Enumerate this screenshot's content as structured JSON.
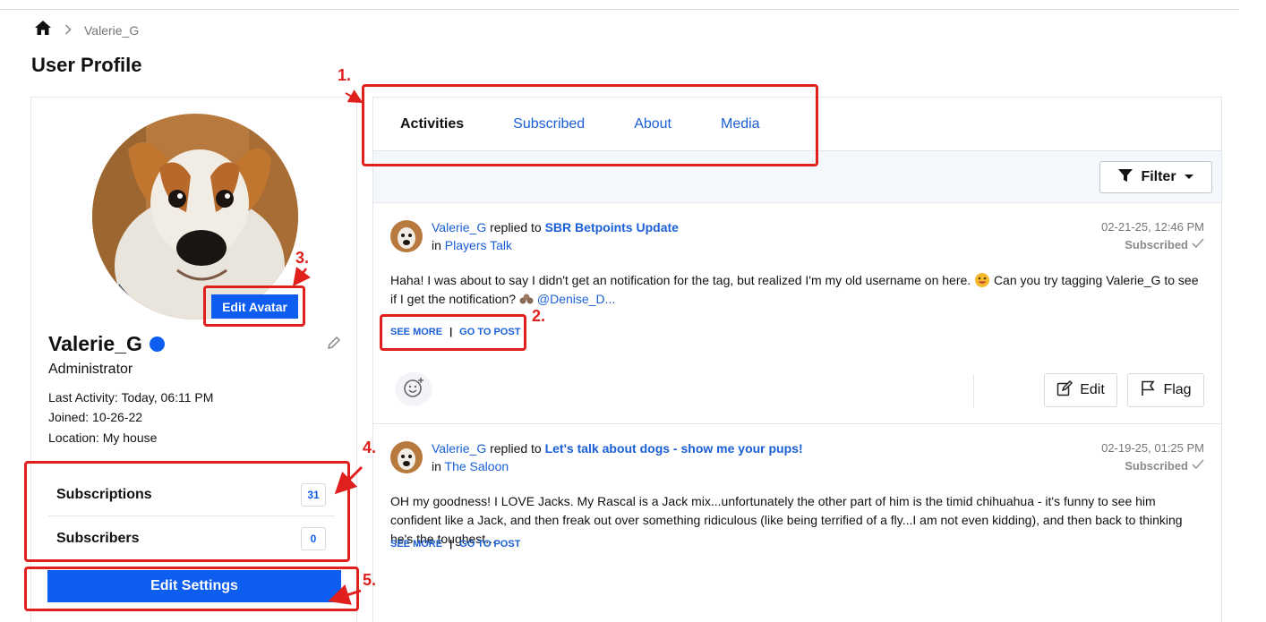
{
  "breadcrumb": {
    "current": "Valerie_G"
  },
  "page": {
    "title": "User Profile"
  },
  "profile": {
    "username": "Valerie_G",
    "role": "Administrator",
    "last_activity": "Last Activity: Today, 06:11 PM",
    "joined": "Joined: 10-26-22",
    "location": "Location: My house",
    "edit_avatar_label": "Edit Avatar",
    "subscriptions_label": "Subscriptions",
    "subscriptions_count": "31",
    "subscribers_label": "Subscribers",
    "subscribers_count": "0",
    "edit_settings_label": "Edit Settings"
  },
  "tabs": [
    {
      "label": "Activities",
      "active": true
    },
    {
      "label": "Subscribed"
    },
    {
      "label": "About"
    },
    {
      "label": "Media"
    }
  ],
  "filter": {
    "label": "Filter"
  },
  "posts": [
    {
      "author": "Valerie_G",
      "action": "replied to",
      "thread": "SBR Betpoints Update",
      "in_label": "in",
      "forum": "Players Talk",
      "date": "02-21-25, 12:46 PM",
      "subscribed": "Subscribed",
      "body_1": "Haha! I was about to say I didn't get an notification for the tag, but realized I'm my old username on here.",
      "body_2": "Can you try tagging Valerie_G to see if I get the notification?",
      "mention": "@Denise_D...",
      "see_more": "SEE MORE",
      "go_to_post": "GO TO POST",
      "edit_label": "Edit",
      "flag_label": "Flag"
    },
    {
      "author": "Valerie_G",
      "action": "replied to",
      "thread": "Let's talk about dogs - show me your pups!",
      "in_label": "in",
      "forum": "The Saloon",
      "date": "02-19-25, 01:25 PM",
      "subscribed": "Subscribed",
      "body": "OH my goodness! I LOVE Jacks. My Rascal is a Jack mix...unfortunately the other part of him is the timid chihuahua - it's funny to see him confident like a Jack, and then freak out over something ridiculous (like being terrified of a fly...I am not even kidding), and then back to thinking he's the toughest...",
      "see_more": "SEE MORE",
      "go_to_post": "GO TO POST"
    }
  ],
  "annotations": [
    "1.",
    "2.",
    "3.",
    "4.",
    "5."
  ],
  "colors": {
    "accent": "#0d5ef0",
    "link": "#1a5fd6",
    "annotation": "#e0201c",
    "online": "#0d5ef0"
  }
}
